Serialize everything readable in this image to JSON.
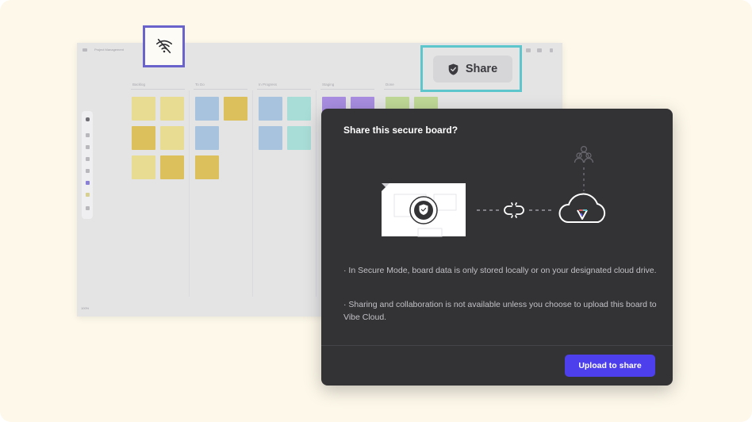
{
  "board": {
    "title": "Project Management",
    "zoom": "100%",
    "columns": [
      {
        "label": "Backlog"
      },
      {
        "label": "To Do"
      },
      {
        "label": "In Progress"
      },
      {
        "label": "Staging"
      },
      {
        "label": "Done"
      }
    ]
  },
  "highlight": {
    "share_label": "Share"
  },
  "icons": {
    "offline": "wifi-off-icon",
    "shield": "shield-check-icon",
    "link": "broken-link-icon",
    "cloud": "cloud-icon",
    "users": "users-icon"
  },
  "dialog": {
    "title": "Share this secure board?",
    "bullets": [
      "· In Secure Mode, board data is only stored locally or on your designated cloud drive.",
      "· Sharing and collaboration is not available unless you choose to upload this board to Vibe Cloud."
    ],
    "upload_label": "Upload to share"
  },
  "colors": {
    "offline_border": "#6a63cc",
    "share_highlight": "#5cc6cc",
    "primary": "#4d40ec",
    "dialog_bg": "#333336"
  }
}
